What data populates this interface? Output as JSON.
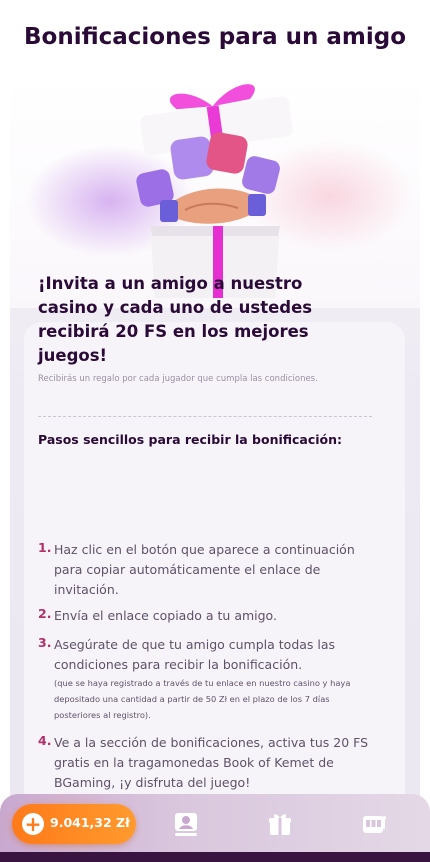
{
  "page_title": "Bonificaciones para un amigo",
  "invite": {
    "heading": "¡Invita a un amigo a nuestro casino y cada uno de ustedes recibirá 20 FS en los mejores juegos!",
    "subtext": "Recibirás un regalo por cada jugador que cumpla las condiciones."
  },
  "steps": {
    "title": "Pasos sencillos para recibir la bonificación:",
    "items": [
      {
        "num": "1.",
        "text": "Haz clic en el botón que aparece a continuación para copiar automáticamente el enlace de invitación."
      },
      {
        "num": "2.",
        "text": "Envía el enlace copiado a tu amigo."
      },
      {
        "num": "3.",
        "text": "Asegúrate de que tu amigo cumpla todas las condiciones para recibir la bonificación.",
        "note": "(que se haya registrado a través de tu enlace en nuestro casino y haya depositado una cantidad a partir de 50 Zł en el plazo de los 7 días posteriores al registro)."
      },
      {
        "num": "4.",
        "text": "Ve a la sección de bonificaciones, activa tus 20 FS gratis en la tragamonedas Book of Kemet de BGaming, ¡y disfruta del juego!"
      }
    ]
  },
  "bottom_nav": {
    "balance": "9.041,32 Zł",
    "icons": [
      "plus-icon",
      "profile-icon",
      "gift-icon",
      "slots-icon"
    ]
  },
  "colors": {
    "title": "#2a0a36",
    "accent_pink": "#b2306b",
    "balance_orange": "#ff7a1a"
  }
}
